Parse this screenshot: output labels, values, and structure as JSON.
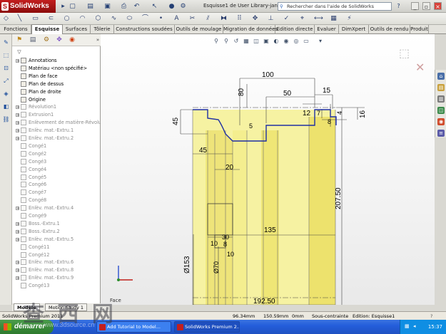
{
  "app": {
    "name": "SolidWorks",
    "doc_title": "Esquisse1 de User Library-jante...",
    "help_placeholder": "Rechercher dans l'aide de SolidWorks"
  },
  "command_tabs": [
    "Fonctions",
    "Esquisse",
    "Surfaces",
    "Tôlerie",
    "Constructions soudées",
    "Outils de moulage",
    "Migration de données",
    "Edition directe",
    "Evaluer",
    "DimXpert",
    "Outils de rendu",
    "Produit"
  ],
  "active_tab": "Esquisse",
  "tree": [
    {
      "label": "Annotations",
      "dim": false,
      "exp": "+"
    },
    {
      "label": "Matériau <non spécifié>",
      "dim": false,
      "exp": ""
    },
    {
      "label": "Plan de face",
      "dim": false,
      "exp": ""
    },
    {
      "label": "Plan de dessus",
      "dim": false,
      "exp": ""
    },
    {
      "label": "Plan de droite",
      "dim": false,
      "exp": ""
    },
    {
      "label": "Origine",
      "dim": false,
      "exp": ""
    },
    {
      "label": "Révolution1",
      "dim": true,
      "exp": "+"
    },
    {
      "label": "Extrusion1",
      "dim": true,
      "exp": "+"
    },
    {
      "label": "Enlèvement de matière-Révolu",
      "dim": true,
      "exp": "+"
    },
    {
      "label": "Enlèv. mat.-Extru.1",
      "dim": true,
      "exp": "+"
    },
    {
      "label": "Enlèv. mat.-Extru.2",
      "dim": true,
      "exp": "+"
    },
    {
      "label": "Congé1",
      "dim": true,
      "exp": ""
    },
    {
      "label": "Congé2",
      "dim": true,
      "exp": ""
    },
    {
      "label": "Congé3",
      "dim": true,
      "exp": ""
    },
    {
      "label": "Congé4",
      "dim": true,
      "exp": ""
    },
    {
      "label": "Congé5",
      "dim": true,
      "exp": ""
    },
    {
      "label": "Congé6",
      "dim": true,
      "exp": ""
    },
    {
      "label": "Congé7",
      "dim": true,
      "exp": ""
    },
    {
      "label": "Congé8",
      "dim": true,
      "exp": ""
    },
    {
      "label": "Enlèv. mat.-Extru.4",
      "dim": true,
      "exp": "+"
    },
    {
      "label": "Congé9",
      "dim": true,
      "exp": ""
    },
    {
      "label": "Boss.-Extru.1",
      "dim": true,
      "exp": "+"
    },
    {
      "label": "Boss.-Extru.2",
      "dim": true,
      "exp": "+"
    },
    {
      "label": "Enlèv. mat.-Extru.5",
      "dim": true,
      "exp": "+"
    },
    {
      "label": "Congé11",
      "dim": true,
      "exp": ""
    },
    {
      "label": "Congé12",
      "dim": true,
      "exp": ""
    },
    {
      "label": "Enlèv. mat.-Extru.6",
      "dim": true,
      "exp": "+"
    },
    {
      "label": "Enlèv. mat.-Extru.8",
      "dim": true,
      "exp": "+"
    },
    {
      "label": "Enlèv. mat.-Extru.9",
      "dim": true,
      "exp": "+"
    },
    {
      "label": "Congé13",
      "dim": true,
      "exp": ""
    }
  ],
  "bottom_tabs": [
    "Modèle",
    "Motion Study 1"
  ],
  "view_label": "Face",
  "dimensions": {
    "d100": "100",
    "d80": "80",
    "d50": "50",
    "d15": "15",
    "d4a": "4",
    "d16": "16",
    "d5a": "5",
    "d12": "12",
    "d7": "7",
    "d8": "8",
    "d45v": "45",
    "d5b": "5",
    "d45h": "45",
    "d20": "20",
    "d207": "207.50",
    "d135": "135",
    "d30": "30",
    "d10a": "10",
    "d8b": "8",
    "d10b": "10",
    "d153": "Ø153",
    "d70": "Ø70",
    "d192": "192.50"
  },
  "status": {
    "product": "SolidWorks Premium 2011",
    "x": "96.34mm",
    "y": "150.59mm",
    "z": "0mm",
    "state": "Sous-contrainte",
    "mode": "Edition: Esquisse1"
  },
  "taskbar": {
    "start": "démarrer",
    "tasks": [
      "Add Tutorial to Model...",
      "SolidWorks Premium 2..."
    ],
    "clock": "15:37"
  },
  "watermark": {
    "chars": "查 西 网",
    "site": "www.3dsource.cn"
  }
}
